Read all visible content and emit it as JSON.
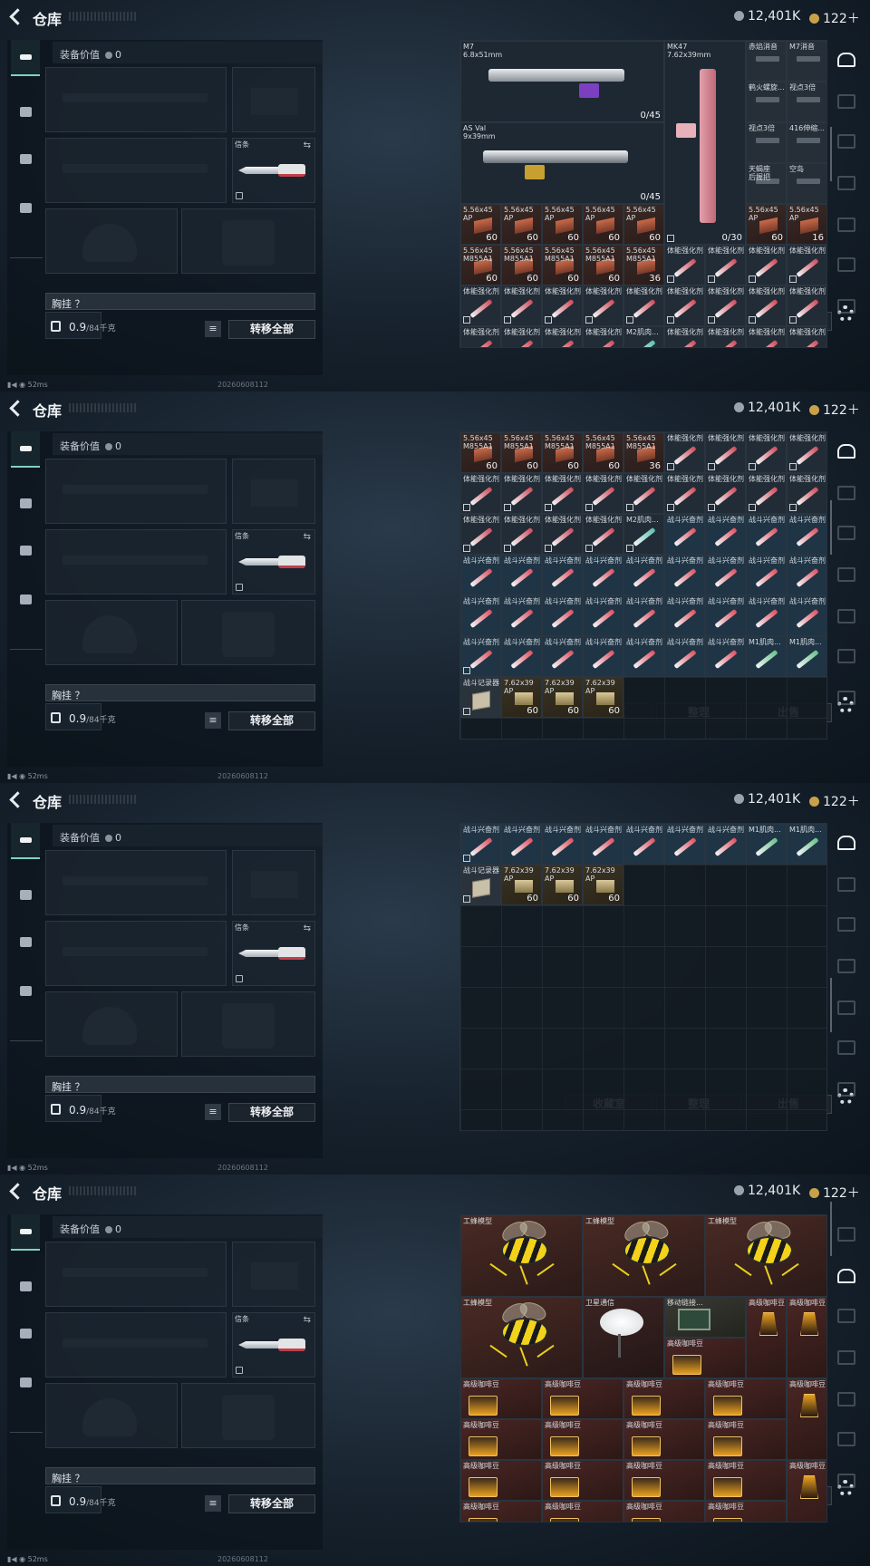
{
  "header": {
    "title": "仓库",
    "currency_silver": "12,401K",
    "currency_gold": "122＋"
  },
  "left": {
    "equip_value_label": "装备价值",
    "equip_value": "0",
    "knife_label": "信条",
    "chest_label": "胸挂",
    "chest_q": "？",
    "weight_value": "0.9",
    "weight_max": "/84千克",
    "transfer_all": "转移全部",
    "list_icon": "≡",
    "swap_icon": "⇆"
  },
  "footer": {
    "collect": "收藏室",
    "sort": "整理",
    "sell": "出售"
  },
  "status": {
    "ping": "52ms",
    "stamp": "20260608112"
  },
  "screen1": {
    "items": [
      {
        "name": "M7\n6.8x51mm",
        "qty": "0/45"
      },
      {
        "name": "MK47\n7.62x39mm",
        "qty": "0/30"
      },
      {
        "name": "AS Val\n9x39mm",
        "qty": "0/45"
      },
      {
        "name": "赤焰消音",
        "qty": ""
      },
      {
        "name": "M7消音",
        "qty": ""
      },
      {
        "name": "鹤火螺旋...",
        "qty": ""
      },
      {
        "name": "视点3倍",
        "qty": ""
      },
      {
        "name": "视点3倍",
        "qty": ""
      },
      {
        "name": "416伸缩...",
        "qty": ""
      },
      {
        "name": "天蝎座\n后握把",
        "qty": ""
      },
      {
        "name": "空岛",
        "qty": ""
      },
      {
        "name": "5.56x45\nAP",
        "qty": "60"
      },
      {
        "name": "5.56x45\nAP",
        "qty": "16"
      },
      {
        "name": "5.56x45\nM855A1",
        "qty": "60"
      },
      {
        "name": "5.56x45\nM855A1",
        "qty": "36"
      },
      {
        "name": "体能强化剂",
        "qty": ""
      },
      {
        "name": "M2肌肉...",
        "qty": ""
      }
    ]
  },
  "screen2": {
    "items": [
      {
        "name": "5.56x45\nM855A1",
        "qty": "60"
      },
      {
        "name": "5.56x45\nM855A1",
        "qty": "36"
      },
      {
        "name": "体能强化剂",
        "qty": ""
      },
      {
        "name": "M2肌肉...",
        "qty": ""
      },
      {
        "name": "战斗兴奋剂",
        "qty": ""
      },
      {
        "name": "M1肌肉...",
        "qty": ""
      },
      {
        "name": "战斗记录器",
        "qty": ""
      },
      {
        "name": "7.62x39\nAP",
        "qty": "60"
      }
    ]
  },
  "screen3": {
    "items": [
      {
        "name": "战斗兴奋剂",
        "qty": ""
      },
      {
        "name": "M1肌肉...",
        "qty": ""
      },
      {
        "name": "战斗记录器",
        "qty": ""
      },
      {
        "name": "7.62x39\nAP",
        "qty": "60"
      }
    ]
  },
  "screen4": {
    "items": [
      {
        "name": "工蜂模型",
        "qty": ""
      },
      {
        "name": "卫星通信",
        "qty": ""
      },
      {
        "name": "移动链接...",
        "qty": ""
      },
      {
        "name": "高级咖啡豆",
        "qty": ""
      }
    ]
  },
  "colors": {
    "accent": "#7fd3c0",
    "silver": "#9aa3ad",
    "gold": "#c8a24a",
    "ammo": "#c86a4a",
    "stim": "#e05060"
  },
  "icons": [
    "back-arrow-icon",
    "silver-coin-icon",
    "gold-coin-icon",
    "gun-tab-icon",
    "helmet-tab-icon",
    "bag-tab-icon",
    "case-tab-icon",
    "lock-icon",
    "list-icon",
    "gear-icon",
    "swap-icon"
  ]
}
